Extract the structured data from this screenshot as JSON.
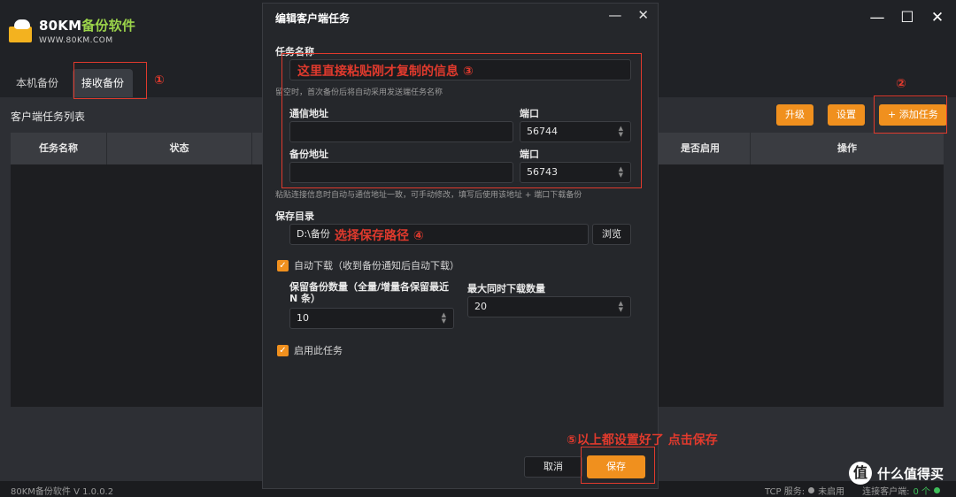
{
  "app": {
    "logo_title": "80KM",
    "logo_title_accent": "备份软件",
    "logo_sub": "WWW.80KM.COM",
    "tabs": [
      {
        "label": "本机备份"
      },
      {
        "label": "接收备份"
      }
    ],
    "list_title": "客户端任务列表",
    "buttons": {
      "upgrade": "升级",
      "settings": "设置",
      "add_task": "+ 添加任务"
    },
    "table_headers": [
      "任务名称",
      "状态",
      "是否启用",
      "操作"
    ],
    "status_left": "80KM备份软件 V 1.0.0.2",
    "status_tcp_label": "TCP 服务:",
    "status_tcp_value": "未启用",
    "status_clients_label": "连接客户端:",
    "status_clients_value": "0 个"
  },
  "modal": {
    "title": "编辑客户端任务",
    "task_name_label": "任务名称",
    "task_name_hint": "留空时，首次备份后将自动采用发送端任务名称",
    "comm_addr_label": "通信地址",
    "comm_port_label": "端口",
    "comm_port_value": "56744",
    "backup_addr_label": "备份地址",
    "backup_port_label": "端口",
    "backup_port_value": "56743",
    "paste_hint": "粘贴连接信息时自动与通信地址一致，可手动修改，填写后使用该地址 + 端口下载备份",
    "save_dir_label": "保存目录",
    "save_dir_value": "D:\\备份",
    "browse_label": "浏览",
    "auto_download_label": "自动下载（收到备份通知后自动下载）",
    "keep_count_label": "保留备份数量（全量/增量各保留最近 N 条）",
    "keep_count_value": "10",
    "max_dl_label": "最大同时下载数量",
    "max_dl_value": "20",
    "enable_task_label": "启用此任务",
    "cancel_label": "取消",
    "save_label": "保存"
  },
  "annotations": {
    "a1": "①",
    "a2": "②",
    "a3": "这里直接粘贴刚才复制的信息  ③",
    "a4": "选择保存路径  ④",
    "a5": "⑤以上都设置好了 点击保存"
  },
  "watermark": {
    "icon": "值",
    "text": "什么值得买"
  },
  "colors": {
    "accent": "#f0901e",
    "annotation": "#e03a2d",
    "background": "#26282c"
  }
}
